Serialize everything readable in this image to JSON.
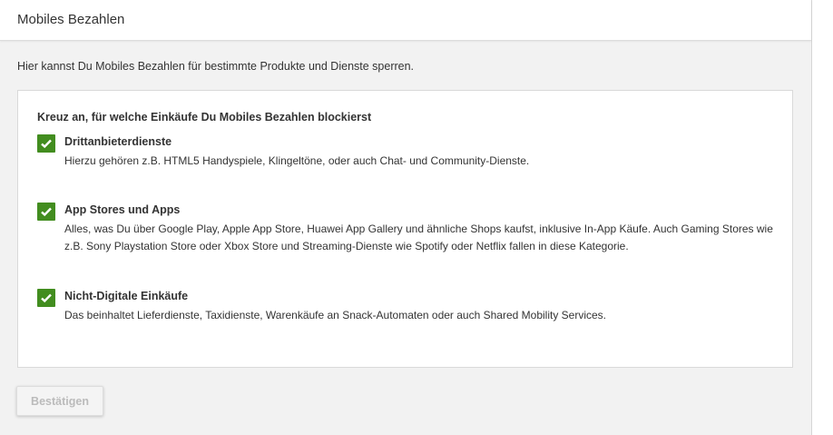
{
  "header": {
    "title": "Mobiles Bezahlen"
  },
  "intro": "Hier kannst Du Mobiles Bezahlen für bestimmte Produkte und Dienste sperren.",
  "card": {
    "title": "Kreuz an, für welche Einkäufe Du Mobiles Bezahlen blockierst",
    "items": [
      {
        "label": "Drittanbieterdienste",
        "description": "Hierzu gehören z.B. HTML5 Handyspiele, Klingeltöne, oder auch Chat- und Community-Dienste.",
        "checked": true
      },
      {
        "label": "App Stores und Apps",
        "description": "Alles, was Du über Google Play, Apple App Store, Huawei App Gallery und ähnliche Shops kaufst, inklusive In-App Käufe. Auch Gaming Stores wie z.B. Sony Playstation Store oder Xbox Store und Streaming-Dienste wie Spotify oder Netflix fallen in diese Kategorie.",
        "checked": true
      },
      {
        "label": "Nicht-Digitale Einkäufe",
        "description": "Das beinhaltet Lieferdienste, Taxidienste, Warenkäufe an Snack-Automaten oder auch Shared Mobility Services.",
        "checked": true
      }
    ]
  },
  "confirm_label": "Bestätigen",
  "colors": {
    "checkbox": "#428d1f",
    "background": "#f2f2f2"
  }
}
